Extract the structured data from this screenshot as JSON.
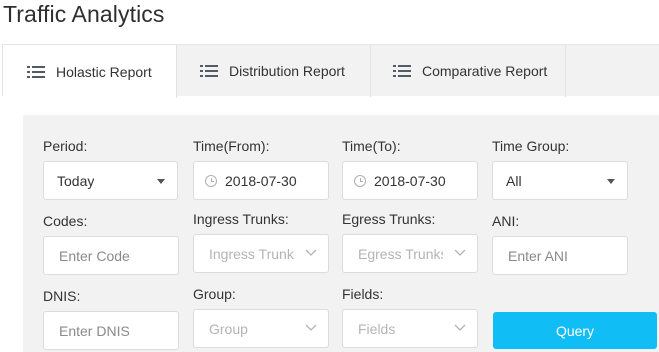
{
  "page": {
    "title": "Traffic Analytics"
  },
  "tabs": [
    {
      "label": "Holastic Report",
      "icon": "list-icon",
      "active": true
    },
    {
      "label": "Distribution Report",
      "icon": "list-icon",
      "active": false
    },
    {
      "label": "Comparative Report",
      "icon": "list-icon",
      "active": false
    }
  ],
  "filters": {
    "period": {
      "label": "Period:",
      "value": "Today"
    },
    "time_from": {
      "label": "Time(From):",
      "value": "2018-07-30"
    },
    "time_to": {
      "label": "Time(To):",
      "value": "2018-07-30"
    },
    "time_group": {
      "label": "Time Group:",
      "value": "All"
    },
    "codes": {
      "label": "Codes:",
      "placeholder": "Enter Code"
    },
    "ingress_trunks": {
      "label": "Ingress Trunks:",
      "placeholder": "Ingress Trunks"
    },
    "egress_trunks": {
      "label": "Egress Trunks:",
      "placeholder": "Egress Trunks"
    },
    "ani": {
      "label": "ANI:",
      "placeholder": "Enter ANI"
    },
    "dnis": {
      "label": "DNIS:",
      "placeholder": "Enter DNIS"
    },
    "group": {
      "label": "Group:",
      "placeholder": "Group"
    },
    "fields": {
      "label": "Fields:",
      "placeholder": "Fields"
    }
  },
  "actions": {
    "query_label": "Query"
  },
  "colors": {
    "accent": "#11bdf5",
    "panel_bg": "#f2f2f2",
    "tab_bg": "#f2f2f2"
  }
}
